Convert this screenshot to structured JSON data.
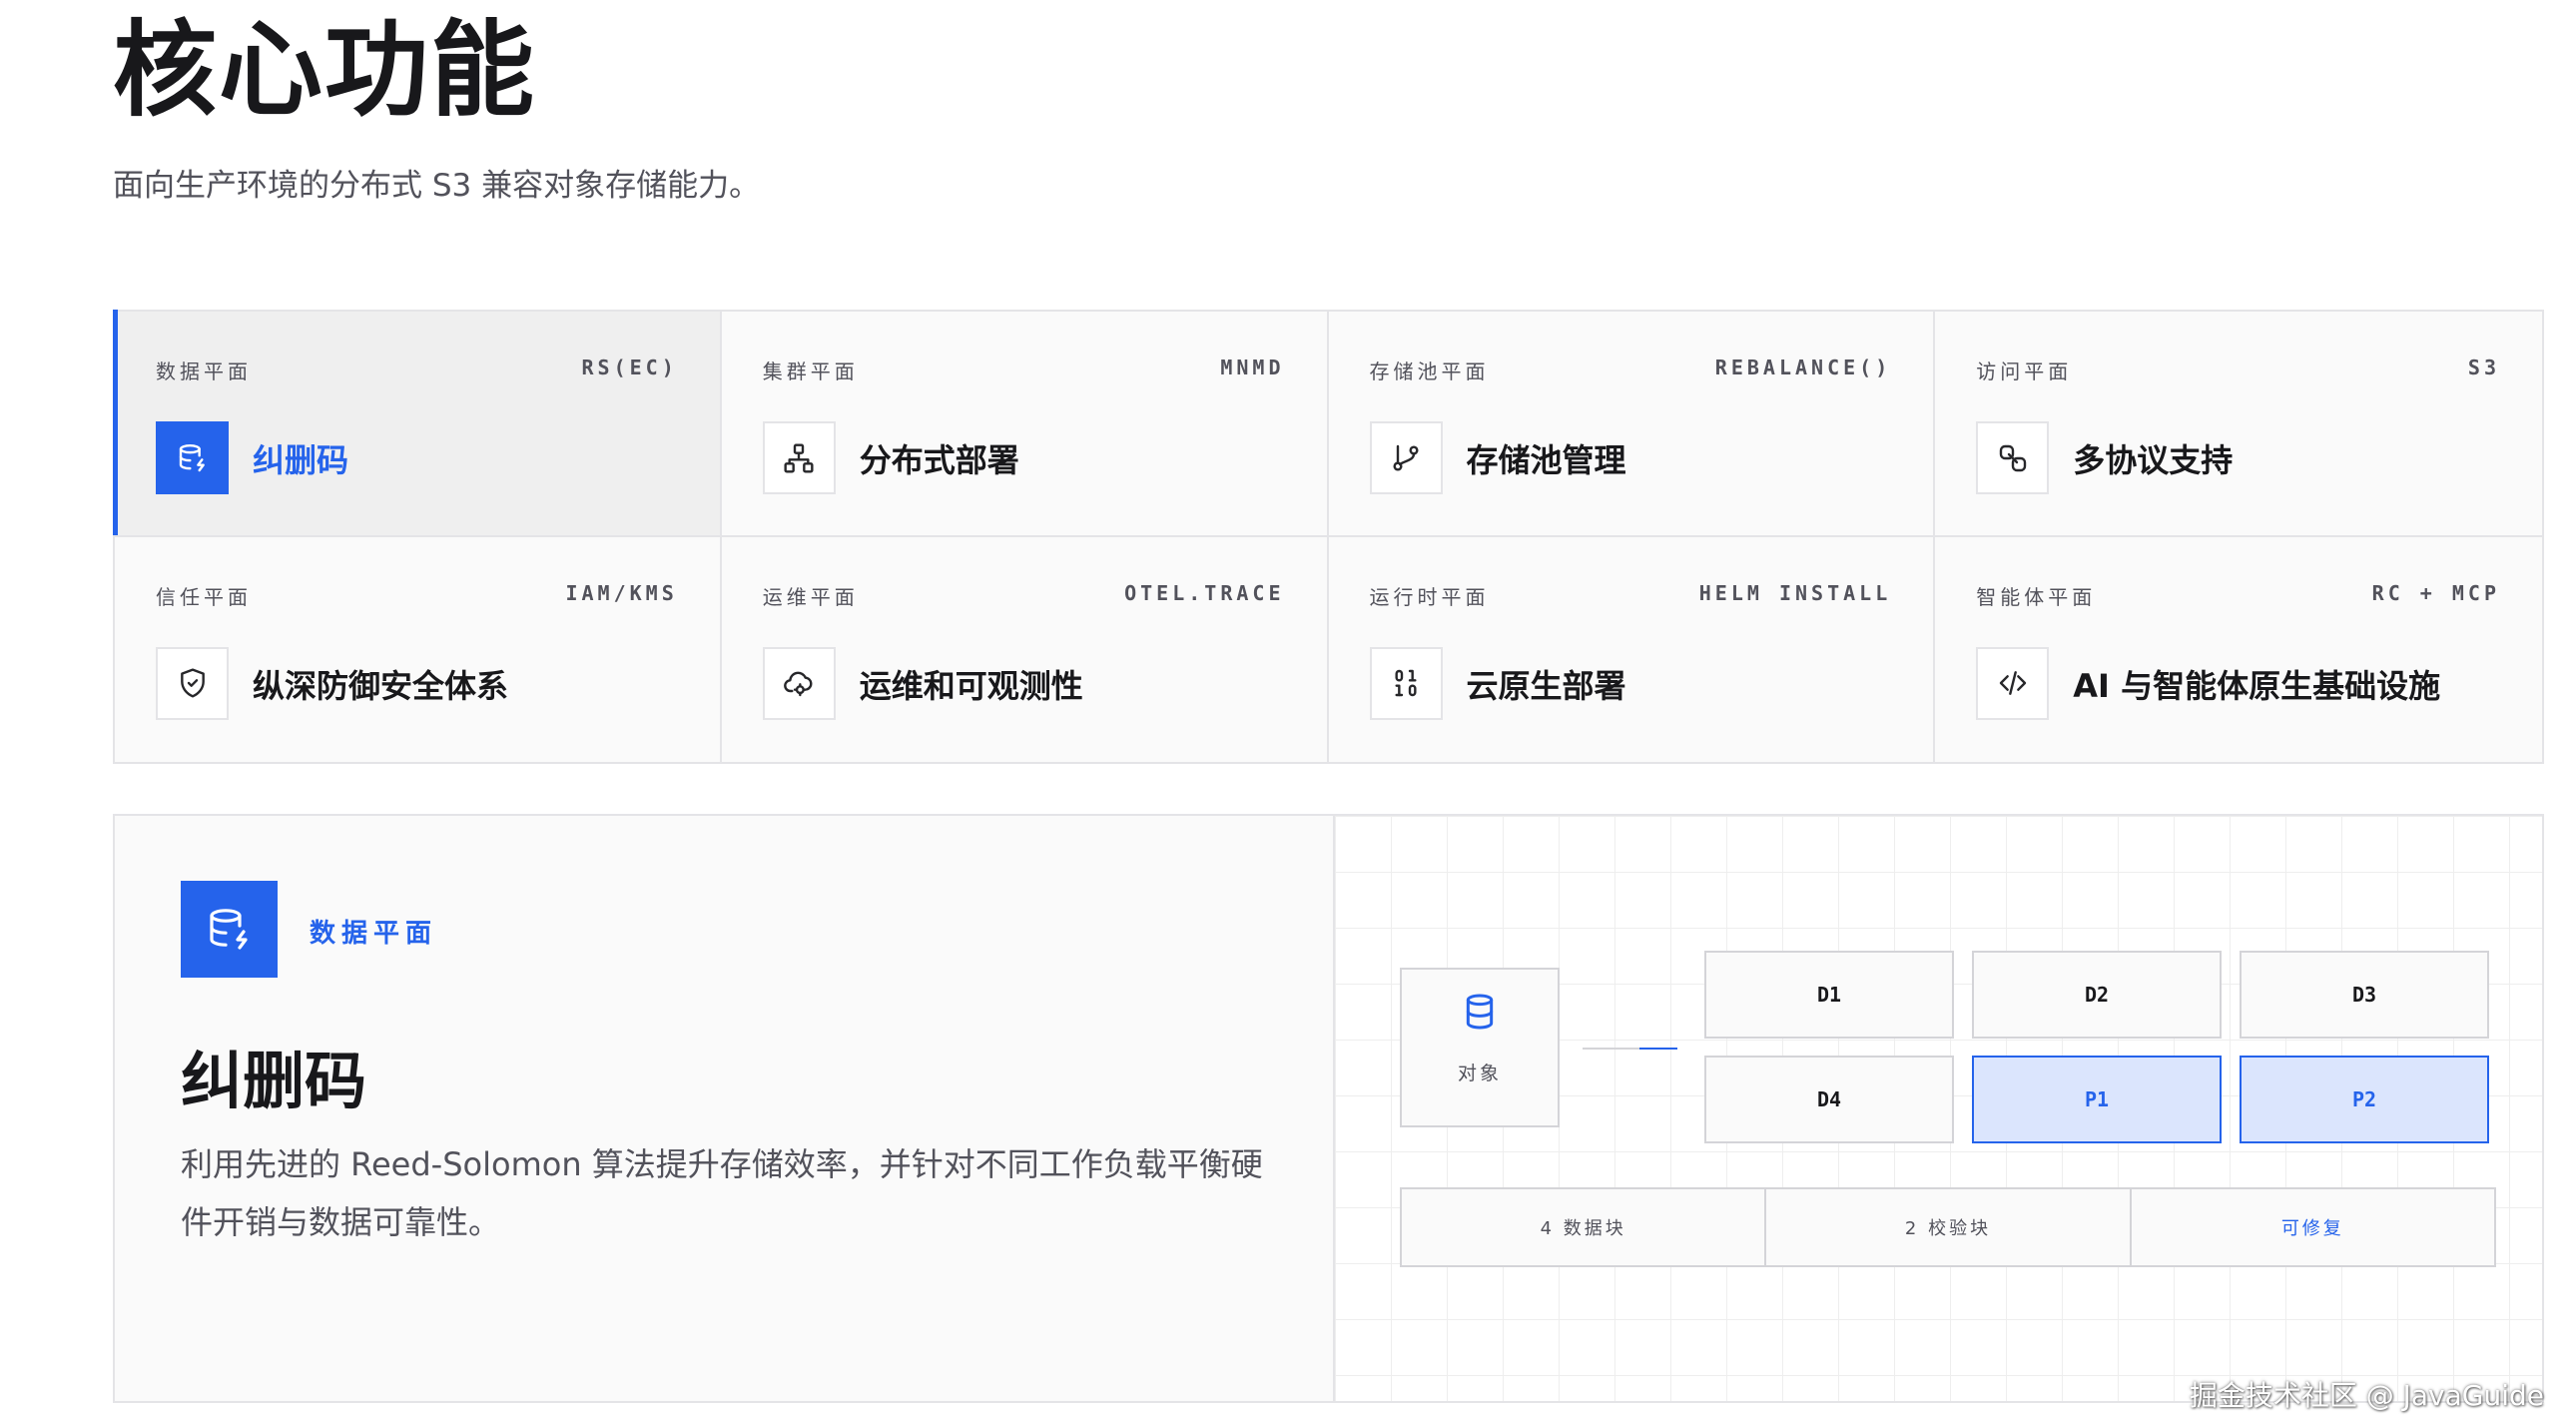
{
  "header": {
    "title": "核心功能",
    "subtitle": "面向生产环境的分布式 S3 兼容对象存储能力。"
  },
  "features": [
    {
      "plane": "数据平面",
      "tag": "RS(EC)",
      "title": "纠删码",
      "icon": "database-bolt-icon",
      "active": true
    },
    {
      "plane": "集群平面",
      "tag": "MNMD",
      "title": "分布式部署",
      "icon": "network-icon",
      "active": false
    },
    {
      "plane": "存储池平面",
      "tag": "REBALANCE()",
      "title": "存储池管理",
      "icon": "git-branch-icon",
      "active": false
    },
    {
      "plane": "访问平面",
      "tag": "S3",
      "title": "多协议支持",
      "icon": "link-icon",
      "active": false
    },
    {
      "plane": "信任平面",
      "tag": "IAM/KMS",
      "title": "纵深防御安全体系",
      "icon": "shield-icon",
      "active": false
    },
    {
      "plane": "运维平面",
      "tag": "OTEL.TRACE",
      "title": "运维和可观测性",
      "icon": "cloud-cog-icon",
      "active": false
    },
    {
      "plane": "运行时平面",
      "tag": "HELM INSTALL",
      "title": "云原生部署",
      "icon": "binary-icon",
      "active": false
    },
    {
      "plane": "智能体平面",
      "tag": "RC + MCP",
      "title": "AI 与智能体原生基础设施",
      "icon": "code-icon",
      "active": false
    }
  ],
  "detail": {
    "plane": "数据平面",
    "title": "纠删码",
    "description": "利用先进的 Reed-Solomon 算法提升存储效率，并针对不同工作负载平衡硬件开销与数据可靠性。",
    "object_label": "对象",
    "data_blocks": [
      "D1",
      "D2",
      "D3",
      "D4"
    ],
    "parity_blocks": [
      "P1",
      "P2"
    ],
    "stats": [
      "4 数据块",
      "2 校验块",
      "可修复"
    ]
  },
  "watermark": "掘金技术社区 @ JavaGuide",
  "colors": {
    "accent": "#2563eb",
    "parity_fill": "#dbe5fd",
    "border": "#e4e4e7"
  }
}
